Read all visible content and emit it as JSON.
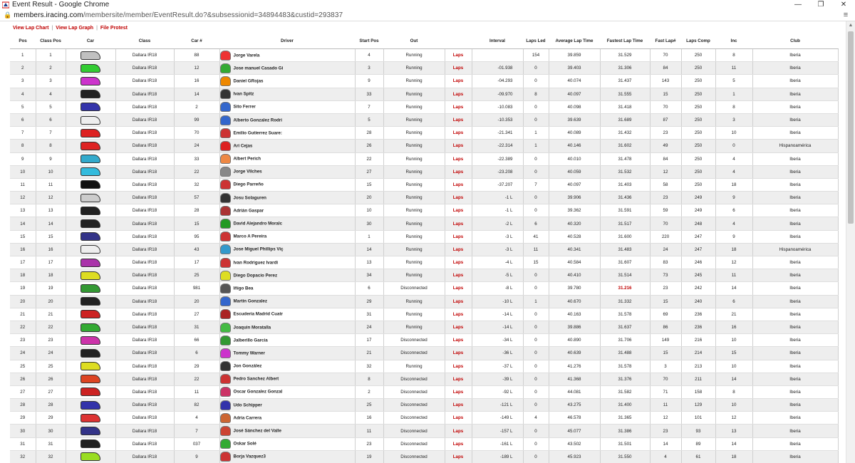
{
  "window": {
    "title": "Event Result - Google Chrome"
  },
  "address": {
    "host": "members.iracing.com",
    "path": "/membersite/member/EventResult.do?&subsessionid=34894483&custid=293837"
  },
  "links": [
    "View Lap Chart",
    "View Lap Graph",
    "File Protest"
  ],
  "columns": [
    "Pos",
    "Class Pos",
    "Car",
    "Class",
    "Car #",
    "Driver",
    "Start Pos",
    "Out",
    "",
    "Interval",
    "Laps Led",
    "Average Lap Time",
    "Fastest Lap Time",
    "Fast Lap#",
    "Laps Comp",
    "Inc",
    "Club"
  ],
  "rows": [
    {
      "pos": "1",
      "cpos": "1",
      "cls": "Dallara IR18",
      "num": "88",
      "driver": "Jorge Varela",
      "start": "4",
      "out": "Running",
      "laps": "Laps",
      "interval": "",
      "led": "154",
      "avg": "39.859",
      "fast": "31.529",
      "fl": "70",
      "comp": "250",
      "inc": "8",
      "club": "Iberia",
      "car": "#c0c0c0",
      "helm": "#e33"
    },
    {
      "pos": "2",
      "cpos": "2",
      "cls": "Dallara IR18",
      "num": "12",
      "driver": "Jose manuel Casado Gi",
      "start": "3",
      "out": "Running",
      "laps": "Laps",
      "interval": "-01.938",
      "led": "0",
      "avg": "39.403",
      "fast": "31.306",
      "fl": "84",
      "comp": "250",
      "inc": "11",
      "club": "Iberia",
      "car": "#33cc33",
      "helm": "#3a3"
    },
    {
      "pos": "3",
      "cpos": "3",
      "cls": "Dallara IR18",
      "num": "16",
      "driver": "Daniel GRojas",
      "start": "9",
      "out": "Running",
      "laps": "Laps",
      "interval": "-04.293",
      "led": "0",
      "avg": "40.074",
      "fast": "31.437",
      "fl": "143",
      "comp": "250",
      "inc": "5",
      "club": "Iberia",
      "car": "#cc33cc",
      "helm": "#e80"
    },
    {
      "pos": "4",
      "cpos": "4",
      "cls": "Dallara IR18",
      "num": "14",
      "driver": "Ivan Spitz",
      "start": "33",
      "out": "Running",
      "laps": "Laps",
      "interval": "-09.970",
      "led": "8",
      "avg": "40.097",
      "fast": "31.555",
      "fl": "15",
      "comp": "250",
      "inc": "1",
      "club": "Iberia",
      "car": "#222222",
      "helm": "#333"
    },
    {
      "pos": "5",
      "cpos": "5",
      "cls": "Dallara IR18",
      "num": "2",
      "driver": "Sito Ferrer",
      "start": "7",
      "out": "Running",
      "laps": "Laps",
      "interval": "-10.083",
      "led": "0",
      "avg": "40.098",
      "fast": "31.418",
      "fl": "70",
      "comp": "250",
      "inc": "8",
      "club": "Iberia",
      "car": "#3333aa",
      "helm": "#36c"
    },
    {
      "pos": "6",
      "cpos": "6",
      "cls": "Dallara IR18",
      "num": "99",
      "driver": "Alberto Gonzalez Rodri",
      "start": "5",
      "out": "Running",
      "laps": "Laps",
      "interval": "-10.353",
      "led": "0",
      "avg": "39.639",
      "fast": "31.689",
      "fl": "87",
      "comp": "250",
      "inc": "3",
      "club": "Iberia",
      "car": "#eeeeee",
      "helm": "#36c"
    },
    {
      "pos": "7",
      "cpos": "7",
      "cls": "Dallara IR18",
      "num": "70",
      "driver": "Emilio Gutierrez Suare:",
      "start": "28",
      "out": "Running",
      "laps": "Laps",
      "interval": "-21.341",
      "led": "1",
      "avg": "40.089",
      "fast": "31.432",
      "fl": "23",
      "comp": "250",
      "inc": "10",
      "club": "Iberia",
      "car": "#dd2222",
      "helm": "#c33"
    },
    {
      "pos": "8",
      "cpos": "8",
      "cls": "Dallara IR18",
      "num": "24",
      "driver": "Ari Cejas",
      "start": "26",
      "out": "Running",
      "laps": "Laps",
      "interval": "-22.314",
      "led": "1",
      "avg": "40.146",
      "fast": "31.602",
      "fl": "49",
      "comp": "250",
      "inc": "0",
      "club": "Hispanoamérica",
      "car": "#dd2222",
      "helm": "#d22"
    },
    {
      "pos": "9",
      "cpos": "9",
      "cls": "Dallara IR18",
      "num": "33",
      "driver": "Albert Perich",
      "start": "22",
      "out": "Running",
      "laps": "Laps",
      "interval": "-22.389",
      "led": "0",
      "avg": "40.010",
      "fast": "31.478",
      "fl": "84",
      "comp": "250",
      "inc": "4",
      "club": "Iberia",
      "car": "#33aacc",
      "helm": "#e84"
    },
    {
      "pos": "10",
      "cpos": "10",
      "cls": "Dallara IR18",
      "num": "22",
      "driver": "Jorge Vilches",
      "start": "27",
      "out": "Running",
      "laps": "Laps",
      "interval": "-23.208",
      "led": "0",
      "avg": "40.059",
      "fast": "31.532",
      "fl": "12",
      "comp": "250",
      "inc": "4",
      "club": "Iberia",
      "car": "#33bbdd",
      "helm": "#888"
    },
    {
      "pos": "11",
      "cpos": "11",
      "cls": "Dallara IR18",
      "num": "32",
      "driver": "Diego Parreño",
      "start": "15",
      "out": "Running",
      "laps": "Laps",
      "interval": "-37.207",
      "led": "7",
      "avg": "40.097",
      "fast": "31.403",
      "fl": "58",
      "comp": "250",
      "inc": "18",
      "club": "Iberia",
      "car": "#111111",
      "helm": "#c33"
    },
    {
      "pos": "12",
      "cpos": "12",
      "cls": "Dallara IR18",
      "num": "57",
      "driver": "Josu Solaguren",
      "start": "20",
      "out": "Running",
      "laps": "Laps",
      "interval": "-1 L",
      "led": "0",
      "avg": "39.906",
      "fast": "31.436",
      "fl": "23",
      "comp": "249",
      "inc": "9",
      "club": "Iberia",
      "car": "#cccccc",
      "helm": "#333"
    },
    {
      "pos": "13",
      "cpos": "13",
      "cls": "Dallara IR18",
      "num": "28",
      "driver": "Adrián Gaspar",
      "start": "10",
      "out": "Running",
      "laps": "Laps",
      "interval": "-1 L",
      "led": "0",
      "avg": "39.362",
      "fast": "31.591",
      "fl": "59",
      "comp": "249",
      "inc": "6",
      "club": "Iberia",
      "car": "#222222",
      "helm": "#a33"
    },
    {
      "pos": "14",
      "cpos": "14",
      "cls": "Dallara IR18",
      "num": "15",
      "driver": "David Alejandro Moralc",
      "start": "30",
      "out": "Running",
      "laps": "Laps",
      "interval": "-2 L",
      "led": "6",
      "avg": "40.320",
      "fast": "31.517",
      "fl": "70",
      "comp": "248",
      "inc": "4",
      "club": "Iberia",
      "car": "#222222",
      "helm": "#292"
    },
    {
      "pos": "15",
      "cpos": "15",
      "cls": "Dallara IR18",
      "num": "95",
      "driver": "Marco A Pereira",
      "start": "1",
      "out": "Running",
      "laps": "Laps",
      "interval": "-3 L",
      "led": "41",
      "avg": "40.528",
      "fast": "31.600",
      "fl": "220",
      "comp": "247",
      "inc": "9",
      "club": "Iberia",
      "car": "#333388",
      "helm": "#c33"
    },
    {
      "pos": "16",
      "cpos": "16",
      "cls": "Dallara IR18",
      "num": "43",
      "driver": "Jose Miguel Phillips Viç",
      "start": "14",
      "out": "Running",
      "laps": "Laps",
      "interval": "-3 L",
      "led": "11",
      "avg": "40.341",
      "fast": "31.483",
      "fl": "24",
      "comp": "247",
      "inc": "18",
      "club": "Hispanoamérica",
      "car": "#eeeeee",
      "helm": "#39c"
    },
    {
      "pos": "17",
      "cpos": "17",
      "cls": "Dallara IR18",
      "num": "17",
      "driver": "Ivan Rodriguez Ivardi",
      "start": "13",
      "out": "Running",
      "laps": "Laps",
      "interval": "-4 L",
      "led": "15",
      "avg": "40.584",
      "fast": "31.607",
      "fl": "83",
      "comp": "246",
      "inc": "12",
      "club": "Iberia",
      "car": "#aa33aa",
      "helm": "#c33"
    },
    {
      "pos": "18",
      "cpos": "18",
      "cls": "Dallara IR18",
      "num": "25",
      "driver": "Diego Dopacio Perez",
      "start": "34",
      "out": "Running",
      "laps": "Laps",
      "interval": "-5 L",
      "led": "0",
      "avg": "40.410",
      "fast": "31.514",
      "fl": "73",
      "comp": "245",
      "inc": "11",
      "club": "Iberia",
      "car": "#dddd22",
      "helm": "#dd2"
    },
    {
      "pos": "19",
      "cpos": "19",
      "cls": "Dallara IR18",
      "num": "981",
      "driver": "Iñigo Bea",
      "start": "6",
      "out": "Disconnected",
      "laps": "Laps",
      "interval": "-8 L",
      "led": "0",
      "avg": "39.780",
      "fast": "31.216",
      "fl": "23",
      "comp": "242",
      "inc": "14",
      "club": "Iberia",
      "car": "#339933",
      "helm": "#555",
      "fastRed": true
    },
    {
      "pos": "20",
      "cpos": "20",
      "cls": "Dallara IR18",
      "num": "20",
      "driver": "Martin Gonzalez",
      "start": "29",
      "out": "Running",
      "laps": "Laps",
      "interval": "-10 L",
      "led": "1",
      "avg": "40.670",
      "fast": "31.332",
      "fl": "15",
      "comp": "240",
      "inc": "6",
      "club": "Iberia",
      "car": "#222222",
      "helm": "#36c"
    },
    {
      "pos": "21",
      "cpos": "21",
      "cls": "Dallara IR18",
      "num": "27",
      "driver": "Escuderia Madrid Cuatr",
      "start": "31",
      "out": "Running",
      "laps": "Laps",
      "interval": "-14 L",
      "led": "0",
      "avg": "40.163",
      "fast": "31.578",
      "fl": "69",
      "comp": "236",
      "inc": "21",
      "club": "Iberia",
      "car": "#cc2222",
      "helm": "#a22"
    },
    {
      "pos": "22",
      "cpos": "22",
      "cls": "Dallara IR18",
      "num": "31",
      "driver": "Joaquin Moratalla",
      "start": "24",
      "out": "Running",
      "laps": "Laps",
      "interval": "-14 L",
      "led": "0",
      "avg": "39.886",
      "fast": "31.637",
      "fl": "86",
      "comp": "236",
      "inc": "16",
      "club": "Iberia",
      "car": "#33aa33",
      "helm": "#4b4"
    },
    {
      "pos": "23",
      "cpos": "23",
      "cls": "Dallara IR18",
      "num": "66",
      "driver": "Jalberillo Garcia",
      "start": "17",
      "out": "Disconnected",
      "laps": "Laps",
      "interval": "-34 L",
      "led": "0",
      "avg": "40.890",
      "fast": "31.706",
      "fl": "149",
      "comp": "216",
      "inc": "10",
      "club": "Iberia",
      "car": "#cc33aa",
      "helm": "#393"
    },
    {
      "pos": "24",
      "cpos": "24",
      "cls": "Dallara IR18",
      "num": "6",
      "driver": "Tommy Warner",
      "start": "21",
      "out": "Disconnected",
      "laps": "Laps",
      "interval": "-36 L",
      "led": "0",
      "avg": "40.639",
      "fast": "31.488",
      "fl": "15",
      "comp": "214",
      "inc": "15",
      "club": "Iberia",
      "car": "#222222",
      "helm": "#c3c"
    },
    {
      "pos": "25",
      "cpos": "25",
      "cls": "Dallara IR18",
      "num": "29",
      "driver": "Jon González",
      "start": "32",
      "out": "Running",
      "laps": "Laps",
      "interval": "-37 L",
      "led": "0",
      "avg": "41.276",
      "fast": "31.578",
      "fl": "3",
      "comp": "213",
      "inc": "10",
      "club": "Iberia",
      "car": "#dddd22",
      "helm": "#333"
    },
    {
      "pos": "26",
      "cpos": "26",
      "cls": "Dallara IR18",
      "num": "22",
      "driver": "Pedro Sanchez Albert",
      "start": "8",
      "out": "Disconnected",
      "laps": "Laps",
      "interval": "-39 L",
      "led": "0",
      "avg": "41.368",
      "fast": "31.376",
      "fl": "70",
      "comp": "211",
      "inc": "14",
      "club": "Iberia",
      "car": "#dd4422",
      "helm": "#c33"
    },
    {
      "pos": "27",
      "cpos": "27",
      "cls": "Dallara IR18",
      "num": "11",
      "driver": "Oscar Gonzalez Gonzal",
      "start": "2",
      "out": "Disconnected",
      "laps": "Laps",
      "interval": "-92 L",
      "led": "0",
      "avg": "44.081",
      "fast": "31.582",
      "fl": "71",
      "comp": "158",
      "inc": "8",
      "club": "Iberia",
      "car": "#cc2222",
      "helm": "#c36"
    },
    {
      "pos": "28",
      "cpos": "28",
      "cls": "Dallara IR18",
      "num": "82",
      "driver": "Udo Schipper",
      "start": "25",
      "out": "Disconnected",
      "laps": "Laps",
      "interval": "-121 L",
      "led": "0",
      "avg": "43.275",
      "fast": "31.400",
      "fl": "11",
      "comp": "129",
      "inc": "10",
      "club": "Iberia",
      "car": "#3333aa",
      "helm": "#33a"
    },
    {
      "pos": "29",
      "cpos": "29",
      "cls": "Dallara IR18",
      "num": "4",
      "driver": "Adria Carrera",
      "start": "16",
      "out": "Disconnected",
      "laps": "Laps",
      "interval": "-149 L",
      "led": "4",
      "avg": "46.578",
      "fast": "31.365",
      "fl": "12",
      "comp": "101",
      "inc": "12",
      "club": "Iberia",
      "car": "#dd3333",
      "helm": "#c63"
    },
    {
      "pos": "30",
      "cpos": "30",
      "cls": "Dallara IR18",
      "num": "7",
      "driver": "José Sánchez del Valle",
      "start": "11",
      "out": "Disconnected",
      "laps": "Laps",
      "interval": "-157 L",
      "led": "0",
      "avg": "45.077",
      "fast": "31.386",
      "fl": "23",
      "comp": "93",
      "inc": "13",
      "club": "Iberia",
      "car": "#333388",
      "helm": "#c43"
    },
    {
      "pos": "31",
      "cpos": "31",
      "cls": "Dallara IR18",
      "num": "037",
      "driver": "Oskar Solé",
      "start": "23",
      "out": "Disconnected",
      "laps": "Laps",
      "interval": "-161 L",
      "led": "0",
      "avg": "43.502",
      "fast": "31.501",
      "fl": "14",
      "comp": "89",
      "inc": "14",
      "club": "Iberia",
      "car": "#222222",
      "helm": "#3a3"
    },
    {
      "pos": "32",
      "cpos": "32",
      "cls": "Dallara IR18",
      "num": "9",
      "driver": "Borja Vazquez3",
      "start": "19",
      "out": "Disconnected",
      "laps": "Laps",
      "interval": "-189 L",
      "led": "0",
      "avg": "45.923",
      "fast": "31.550",
      "fl": "4",
      "comp": "61",
      "inc": "18",
      "club": "Iberia",
      "car": "#99dd22",
      "helm": "#c33"
    }
  ]
}
